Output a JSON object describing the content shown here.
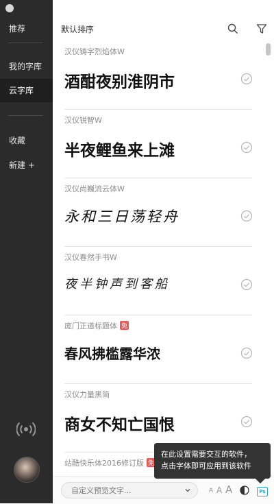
{
  "sidebar": {
    "items": [
      {
        "label": "推荐",
        "active": false
      },
      {
        "label": "我的字库",
        "active": false
      },
      {
        "label": "云字库",
        "active": true
      },
      {
        "label": "收藏",
        "active": false
      },
      {
        "label": "新建 +",
        "active": false
      }
    ],
    "radio_icon": "broadcast-icon",
    "avatar": "user-avatar"
  },
  "header": {
    "sort_label": "默认排序",
    "search_icon": "search-icon",
    "filter_icon": "filter-icon"
  },
  "fonts": [
    {
      "name": "汉仪铸字烈焰体W",
      "preview": "酒酣夜别淮阴市",
      "free_badge": ""
    },
    {
      "name": "汉仪锐智W",
      "preview": "半夜鲤鱼来上滩",
      "free_badge": ""
    },
    {
      "name": "汉仪尚巍流云体W",
      "preview": "永和三日荡轻舟",
      "free_badge": ""
    },
    {
      "name": "汉仪春然手书W",
      "preview": "夜半钟声到客船",
      "free_badge": ""
    },
    {
      "name": "庞门正道标题体",
      "preview": "春风拂槛露华浓",
      "free_badge": "免"
    },
    {
      "name": "汉仪力量黑简",
      "preview": "商女不知亡国恨",
      "free_badge": ""
    },
    {
      "name": "站酷快乐体2016修订版",
      "preview": "",
      "free_badge": "免"
    }
  ],
  "footer": {
    "preview_placeholder": "自定义预览文字...",
    "size_small": "A",
    "size_medium": "A",
    "size_large": "A",
    "contrast_icon": "contrast-icon",
    "app_badge": "Ps"
  },
  "tooltip": {
    "line1": "在此设置需要交互的软件，",
    "line2": "点击字体即可应用到该软件"
  },
  "colors": {
    "sidebar_bg": "#2b2b2b",
    "free_badge": "#e55a5a",
    "ps_accent": "#2aa3d8"
  }
}
